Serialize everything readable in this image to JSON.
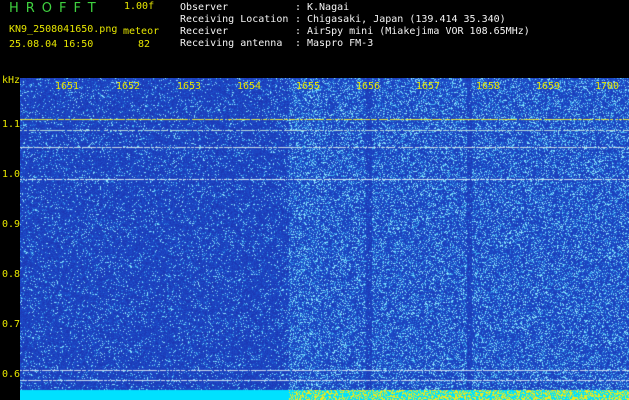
{
  "header": {
    "app_title": "HROFFT",
    "version": "1.00f",
    "filename": "KN9_2508041650.png",
    "mode": "meteor",
    "datetime": "25.08.04 16:50",
    "count": "82"
  },
  "info": [
    {
      "key": "Observer",
      "value": "K.Nagai"
    },
    {
      "key": "Receiving Location",
      "value": "Chigasaki, Japan (139.414 35.340)"
    },
    {
      "key": "Receiver",
      "value": "AirSpy mini (Miakejima VOR 108.65MHz)"
    },
    {
      "key": "Receiving antenna",
      "value": "Maspro FM-3"
    }
  ],
  "info_separator": ":",
  "chart_data": {
    "type": "heatmap",
    "ylabel": "kHz",
    "x_ticks": [
      "1651",
      "1652",
      "1653",
      "1654",
      "1655",
      "1656",
      "1657",
      "1658",
      "1659",
      "1700"
    ],
    "y_ticks": [
      "1.1",
      "1.0",
      "0.9",
      "0.8",
      "0.7",
      "0.6"
    ],
    "ylim": [
      0.58,
      1.17
    ],
    "colors": {
      "background": "#1c35b8",
      "noise": "#55c8ff",
      "marker": "#e6e600",
      "baseline": "#00e5ff"
    }
  }
}
